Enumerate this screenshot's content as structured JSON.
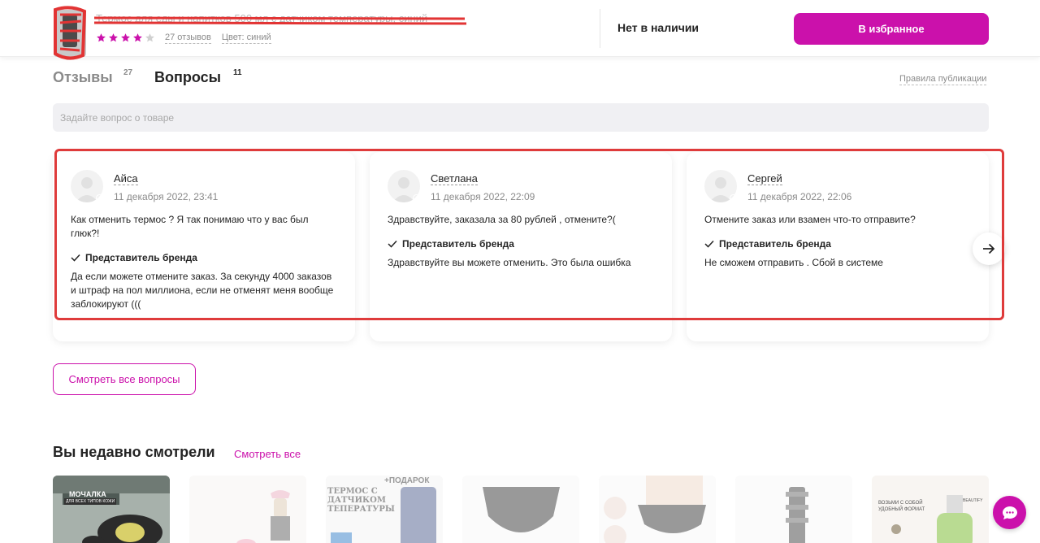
{
  "header": {
    "product_title": "Термос для еды и напитков 500 мл с датчиком температуры, синий",
    "reviews_link": "27 отзывов",
    "color_label": "Цвет: синий",
    "rating": 4,
    "rating_max": 5,
    "stock_status": "Нет в наличии",
    "favorite_button": "В избранное",
    "accent_color": "#cb11ab"
  },
  "tabs": {
    "reviews_label": "Отзывы",
    "reviews_count": "27",
    "questions_label": "Вопросы",
    "questions_count": "11",
    "rules_link": "Правила публикации"
  },
  "ask": {
    "placeholder": "Задайте вопрос о товаре"
  },
  "questions": [
    {
      "user": "Айса",
      "date": "11 декабря 2022, 23:41",
      "question": "Как отменить термос ? Я так понимаю что у вас был глюк?!",
      "responder": "Представитель бренда",
      "answer": "Да если можете отмените заказ. За секунду 4000 заказов и штраф на пол миллиона, если не отменят меня вообще заблокируют (((",
      "flag": "ru"
    },
    {
      "user": "Светлана",
      "date": "11 декабря 2022, 22:09",
      "question": "Здравствуйте, заказала за 80 рублей , отмените?(",
      "responder": "Представитель бренда",
      "answer": "Здравствуйте вы можете отменить. Это была ошибка",
      "flag": "ru"
    },
    {
      "user": "Сергей",
      "date": "11 декабря 2022, 22:06",
      "question": "Отмените заказ или взамен что-то отправите?",
      "responder": "Представитель бренда",
      "answer": "Не сможем отправить . Сбой в системе",
      "flag": "ru"
    }
  ],
  "carousel": {
    "next_icon": "arrow-right-icon"
  },
  "all_questions_button": "Смотреть все вопросы",
  "recent": {
    "title": "Вы недавно смотрели",
    "see_all": "Смотреть все",
    "tiles": [
      {
        "caption": "МОЧАЛКА",
        "subcaption": "ДЛЯ ВСЕХ ТИПОВ КОЖИ"
      },
      {
        "caption": ""
      },
      {
        "caption": "ТЕРМОС С ДАТЧИКОМ ТЕПЕРАТУРЫ",
        "badge": "+ПОДАРОК"
      },
      {
        "caption": ""
      },
      {
        "caption": ""
      },
      {
        "caption": ""
      },
      {
        "caption": "ВОЗЬМИ С СОБОЙ УДОБНЫЙ ФОРМАТ",
        "brand": "BEAUTIFY"
      }
    ]
  },
  "chat": {
    "icon": "chat-bubble-icon"
  }
}
